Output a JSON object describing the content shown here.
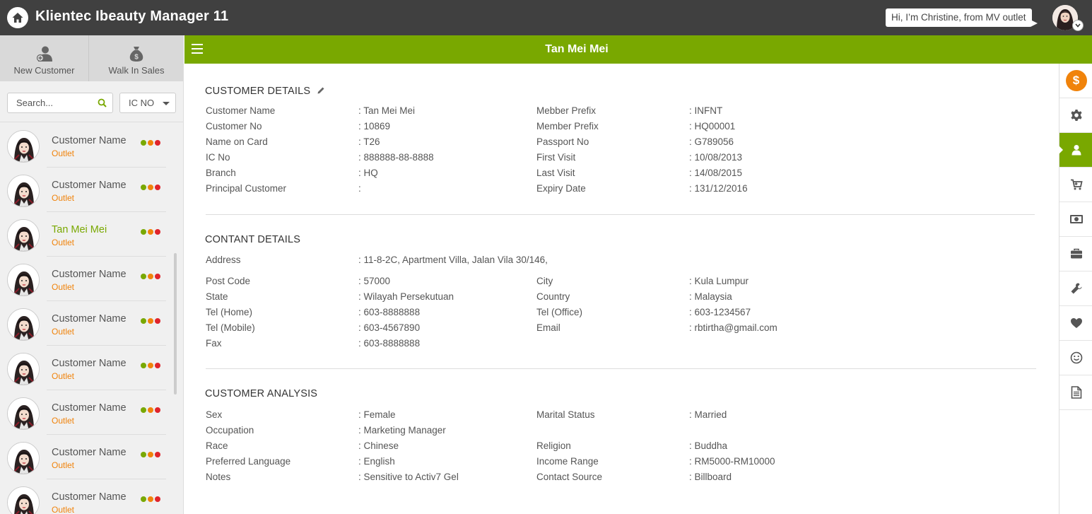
{
  "app": {
    "title": "Klientec Ibeauty Manager 11",
    "greeting": "Hi, I’m Christine, from MV outlet"
  },
  "sidebar": {
    "actions": [
      {
        "label": "New Customer",
        "icon": "add-user-icon"
      },
      {
        "label": "Walk In Sales",
        "icon": "money-bag-icon"
      }
    ],
    "search": {
      "placeholder": "Search...",
      "value": ""
    },
    "filter": {
      "selected": "IC NO"
    },
    "customers": [
      {
        "name": "Customer Name",
        "outlet": "Outlet",
        "active": false
      },
      {
        "name": "Customer Name",
        "outlet": "Outlet",
        "active": false
      },
      {
        "name": "Tan Mei Mei",
        "outlet": "Outlet",
        "active": true
      },
      {
        "name": "Customer Name",
        "outlet": "Outlet",
        "active": false
      },
      {
        "name": "Customer Name",
        "outlet": "Outlet",
        "active": false
      },
      {
        "name": "Customer Name",
        "outlet": "Outlet",
        "active": false
      },
      {
        "name": "Customer Name",
        "outlet": "Outlet",
        "active": false
      },
      {
        "name": "Customer Name",
        "outlet": "Outlet",
        "active": false
      },
      {
        "name": "Customer Name",
        "outlet": "Outlet",
        "active": false
      }
    ],
    "status_colors": [
      "#79a800",
      "#f0830b",
      "#e0242b"
    ]
  },
  "header": {
    "title": "Tan Mei Mei"
  },
  "details": {
    "title": "CUSTOMER DETAILS",
    "left": [
      {
        "label": "Customer Name",
        "value": ": Tan Mei Mei"
      },
      {
        "label": "Customer No",
        "value": ": 10869"
      },
      {
        "label": "Name on Card",
        "value": ": T26"
      },
      {
        "label": "IC No",
        "value": ": 888888-88-8888"
      },
      {
        "label": "Branch",
        "value": ": HQ"
      },
      {
        "label": "Principal Customer",
        "value": ":"
      }
    ],
    "right": [
      {
        "label": "Mebber Prefix",
        "value": ": INFNT"
      },
      {
        "label": "Member Prefix",
        "value": ": HQ00001"
      },
      {
        "label": "Passport No",
        "value": ": G789056"
      },
      {
        "label": "First Visit",
        "value": ": 10/08/2013"
      },
      {
        "label": "Last Visit",
        "value": ": 14/08/2015"
      },
      {
        "label": "Expiry Date",
        "value": ": 131/12/2016"
      }
    ]
  },
  "contact": {
    "title": "CONTANT DETAILS",
    "address": {
      "label": "Address",
      "value": ": 11-8-2C, Apartment Villa, Jalan Vila 30/146,"
    },
    "left": [
      {
        "label": "Post Code",
        "value": ": 57000"
      },
      {
        "label": "State",
        "value": ": Wilayah Persekutuan"
      },
      {
        "label": "Tel (Home)",
        "value": ": 603-8888888"
      },
      {
        "label": "Tel (Mobile)",
        "value": ": 603-4567890"
      },
      {
        "label": "Fax",
        "value": ": 603-8888888"
      }
    ],
    "right": [
      {
        "label": "City",
        "value": ": Kula Lumpur"
      },
      {
        "label": "Country",
        "value": ": Malaysia"
      },
      {
        "label": "Tel (Office)",
        "value": ": 603-1234567"
      },
      {
        "label": "Email",
        "value": ": rbtirtha@gmail.com"
      }
    ]
  },
  "analysis": {
    "title": "CUSTOMER ANALYSIS",
    "left": [
      {
        "label": "Sex",
        "value": ": Female"
      },
      {
        "label": "Occupation",
        "value": ": Marketing Manager"
      },
      {
        "label": "Race",
        "value": ": Chinese"
      },
      {
        "label": "Preferred Language",
        "value": ": English"
      },
      {
        "label": "Notes",
        "value": ": Sensitive to Activ7 Gel"
      }
    ],
    "right": [
      {
        "label": "Marital Status",
        "value": ": Married"
      },
      {
        "label": "",
        "value": ""
      },
      {
        "label": "Religion",
        "value": ": Buddha"
      },
      {
        "label": "Income Range",
        "value": ": RM5000-RM10000"
      },
      {
        "label": "Contact Source",
        "value": ": Billboard"
      }
    ]
  },
  "rail": {
    "coin_symbol": "$",
    "items": [
      "dollar-coin-icon",
      "gear-icon",
      "user-icon",
      "cart-icon",
      "cash-icon",
      "briefcase-icon",
      "wrench-icon",
      "heart-icon",
      "smiley-icon",
      "document-icon"
    ],
    "active": "user-icon",
    "accent": "#79a800",
    "coin_color": "#f0830b"
  }
}
